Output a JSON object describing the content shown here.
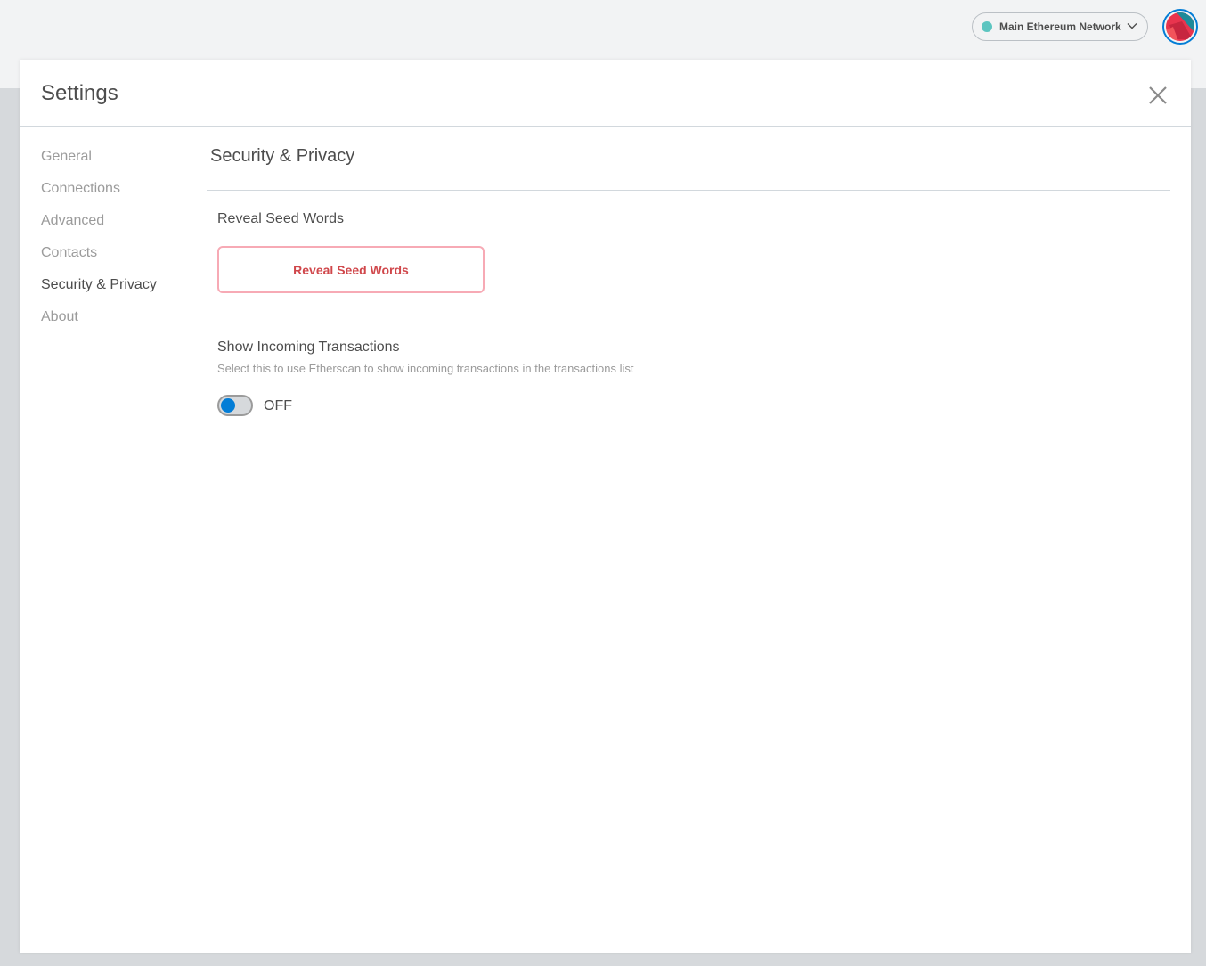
{
  "header": {
    "network": {
      "name": "Main Ethereum Network",
      "status_color": "#29b6af"
    },
    "account_icon": "identicon-avatar"
  },
  "settings": {
    "title": "Settings",
    "close_icon": "close-icon",
    "tabs": [
      {
        "label": "General"
      },
      {
        "label": "Connections"
      },
      {
        "label": "Advanced"
      },
      {
        "label": "Contacts"
      },
      {
        "label": "Security & Privacy",
        "active": true
      },
      {
        "label": "About"
      }
    ],
    "content": {
      "title": "Security & Privacy",
      "reveal_seed": {
        "label": "Reveal Seed Words",
        "button_label": "Reveal Seed Words"
      },
      "incoming_tx": {
        "label": "Show Incoming Transactions",
        "description": "Select this to use Etherscan to show incoming transactions in the transactions list",
        "toggle_state": "OFF",
        "enabled": false
      }
    }
  },
  "colors": {
    "accent_blue": "#037dd6",
    "danger_text": "#d0474b",
    "danger_border": "#f7aab5"
  }
}
